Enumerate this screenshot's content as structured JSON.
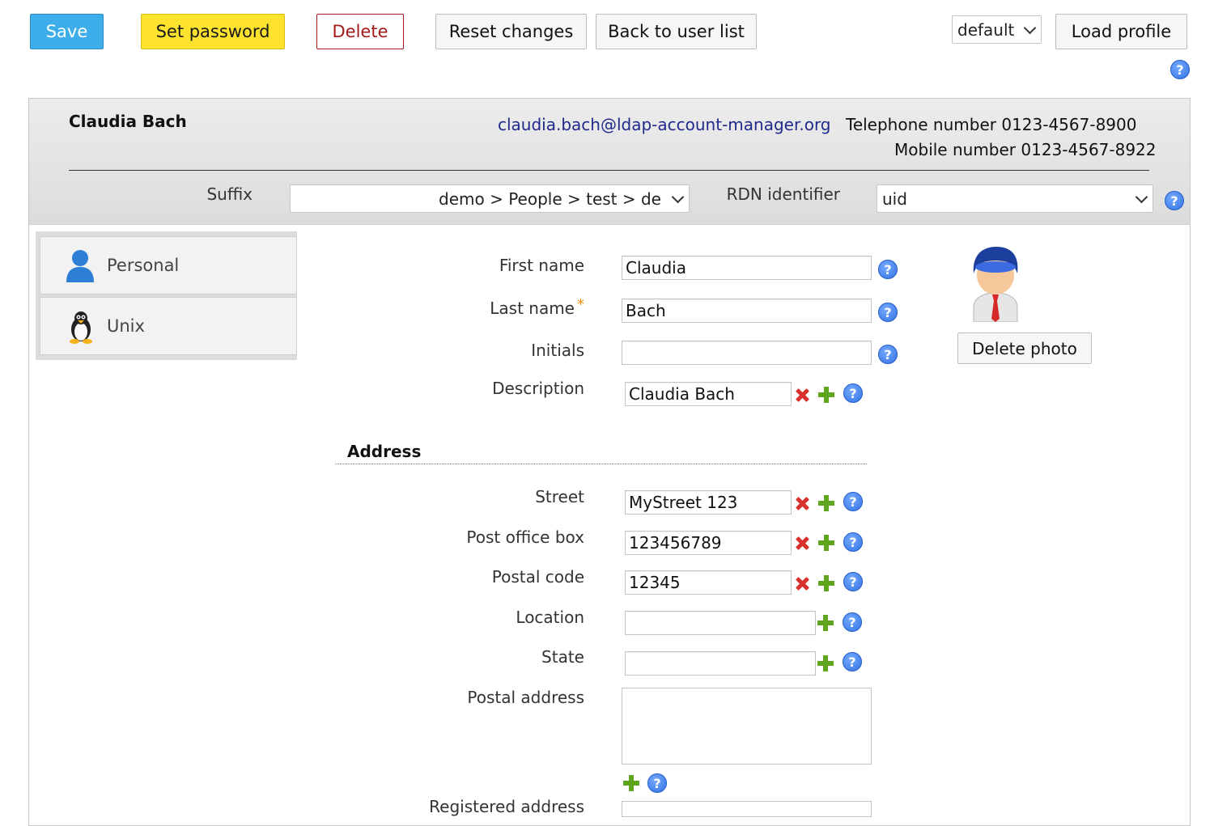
{
  "toolbar": {
    "save": "Save",
    "set_password": "Set password",
    "delete": "Delete",
    "reset": "Reset changes",
    "back": "Back to user list",
    "profile_select": "default",
    "load_profile": "Load profile",
    "help": "?"
  },
  "header": {
    "name": "Claudia Bach",
    "email": "claudia.bach@ldap-account-manager.org",
    "telephone": "Telephone number 0123-4567-8900",
    "mobile": "Mobile number 0123-4567-8922",
    "suffix_label": "Suffix",
    "suffix_value": "demo > People > test > de",
    "rdn_label": "RDN identifier",
    "rdn_value": "uid"
  },
  "tabs": [
    {
      "label": "Personal",
      "icon": "user-icon"
    },
    {
      "label": "Unix",
      "icon": "penguin-icon"
    }
  ],
  "form": {
    "first_name_label": "First name",
    "first_name_value": "Claudia",
    "last_name_label": "Last name",
    "required_mark": "*",
    "last_name_value": "Bach",
    "initials_label": "Initials",
    "initials_value": "",
    "description_label": "Description",
    "description_value": "Claudia Bach",
    "address_heading": "Address",
    "street_label": "Street",
    "street_value": "MyStreet 123",
    "pobox_label": "Post office box",
    "pobox_value": "123456789",
    "postal_code_label": "Postal code",
    "postal_code_value": "12345",
    "location_label": "Location",
    "location_value": "",
    "state_label": "State",
    "state_value": "",
    "postal_address_label": "Postal address",
    "registered_address_label": "Registered address"
  },
  "photo": {
    "delete_photo": "Delete photo"
  },
  "colors": {
    "save": "#3daee9",
    "set_password": "#fde22e",
    "delete": "#a31b1b",
    "help": "#3b82f6",
    "remove": "#d8322c",
    "add": "#5fa61e"
  }
}
